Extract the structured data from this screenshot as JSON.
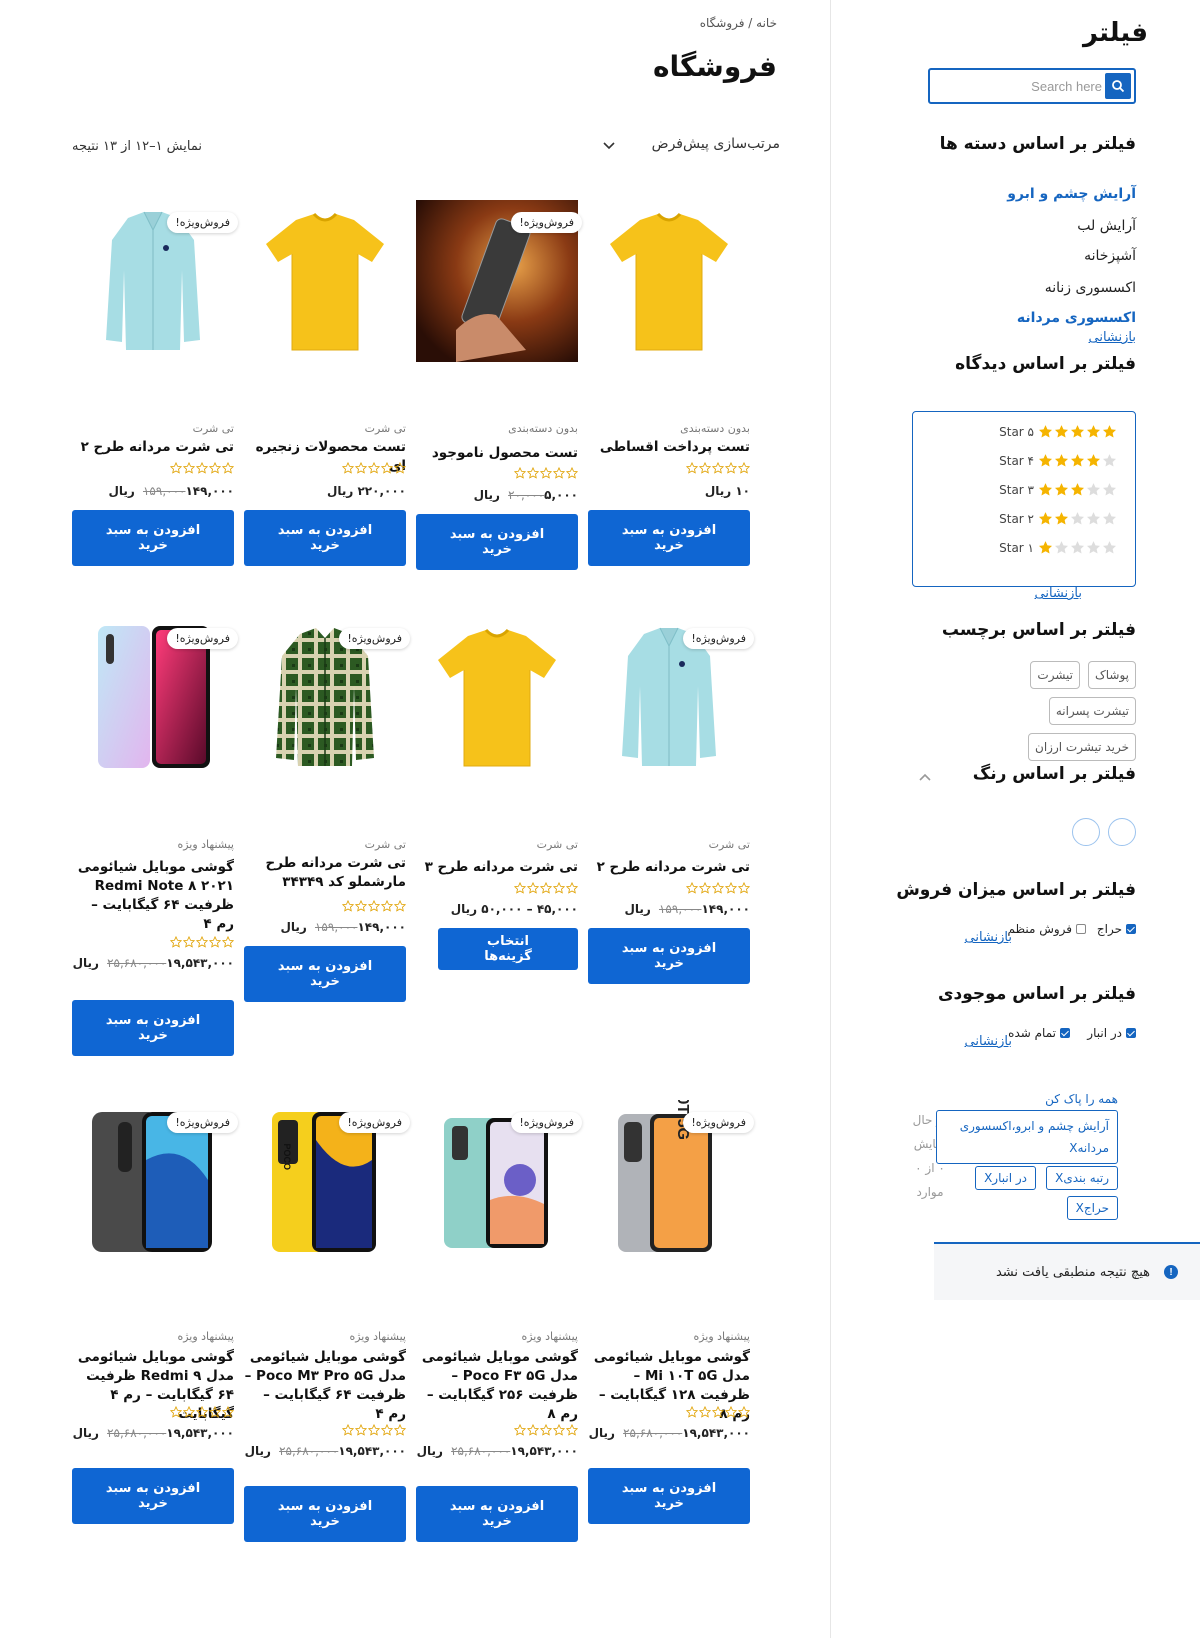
{
  "breadcrumb": "خانه / فروشگاه",
  "title": "فروشگاه",
  "sort_label": "مرتب‌سازی پیش‌فرض",
  "result_count": "نمایش ۱–۱۲ از ۱۳ نتیجه",
  "sidebar": {
    "title": "فیلتر",
    "search_placeholder": "Search here",
    "categories_title": "فیلتر بر اساس دسته ها",
    "categories": [
      {
        "label": "آرایش چشم و ابرو",
        "active": true
      },
      {
        "label": "آرایش لب",
        "active": false
      },
      {
        "label": "آشپزخانه",
        "active": false
      },
      {
        "label": "اکسسوری زنانه",
        "active": false
      },
      {
        "label": "اکسسوری مردانه",
        "active": true
      }
    ],
    "reset": "بازنشانی",
    "ratings_title": "فیلتر بر اساس دیدگاه",
    "ratings": [
      {
        "label": "Star ۵",
        "stars": 5
      },
      {
        "label": "Star ۴",
        "stars": 4
      },
      {
        "label": "Star ۳",
        "stars": 3
      },
      {
        "label": "Star ۲",
        "stars": 2
      },
      {
        "label": "Star ۱",
        "stars": 1
      }
    ],
    "tags_title": "فیلتر بر اساس برچسب",
    "tags": [
      "پوشاک",
      "تیشرت",
      "تیشرت پسرانه",
      "خرید تیشرت ارزان"
    ],
    "color_title": "فیلتر بر اساس رنگ",
    "sale_title": "فیلتر بر اساس میزان فروش",
    "sale_options": [
      {
        "label": "حراج",
        "checked": true
      },
      {
        "label": "فروش منظم",
        "checked": false
      }
    ],
    "stock_title": "فیلتر بر اساس موجودی",
    "stock_options": [
      {
        "label": "در انبار",
        "checked": true
      },
      {
        "label": "تمام شده",
        "checked": true
      }
    ],
    "clear_all": "همه را پاک کن",
    "showing_label": "در حال نمایش ۰ از ۰ موارد",
    "active_filters": [
      "آرایش چشم و ابرو،اکسسوری مردانهX",
      "رتبه بندیX",
      "در انبارX",
      "حراجX"
    ],
    "no_result": "هیچ نتیجه منطبقی یافت نشد",
    "accent": "#1565c0"
  },
  "products": [
    {
      "category": "بدون دسته‌بندی",
      "name": "تست پرداخت اقساطی",
      "price": "۱۰ ریال",
      "old_price": "",
      "button": "افزودن به سبد خرید",
      "sale": false,
      "image": "yellow-tshirt"
    },
    {
      "category": "بدون دسته‌بندی",
      "name": "تست محصول ناموجود",
      "price": "۵,۰۰۰ ریال",
      "old_price": "۲۰,۰۰۰",
      "button": "افزودن به سبد خرید",
      "sale": true,
      "image": "phone-hand"
    },
    {
      "category": "تی شرت",
      "name": "تست محصولات زنجیره ای",
      "price": "۲۲۰,۰۰۰ ریال",
      "old_price": "",
      "button": "افزودن به سبد خرید",
      "sale": false,
      "image": "yellow-tshirt"
    },
    {
      "category": "تی شرت",
      "name": "تی شرت مردانه طرح ۲",
      "price": "۱۴۹,۰۰۰ ریال",
      "old_price": "۱۵۹,۰۰۰",
      "button": "افزودن به سبد خرید",
      "sale": true,
      "image": "blue-shirt"
    },
    {
      "category": "تی شرت",
      "name": "تی شرت مردانه طرح ۲",
      "price": "۱۴۹,۰۰۰ ریال",
      "old_price": "۱۵۹,۰۰۰",
      "button": "افزودن به سبد خرید",
      "sale": true,
      "image": "blue-shirt"
    },
    {
      "category": "تی شرت",
      "name": "تی شرت مردانه طرح ۳",
      "price": "۴۵,۰۰۰ – ۵۰,۰۰۰ ریال",
      "old_price": "",
      "button": "انتخاب گزینه‌ها",
      "sale": false,
      "image": "yellow-tshirt"
    },
    {
      "category": "تی شرت",
      "name": "تی شرت مردانه طرح مارشملو کد ۳۴۳۴۹",
      "price": "۱۴۹,۰۰۰ ریال",
      "old_price": "۱۵۹,۰۰۰",
      "button": "افزودن به سبد خرید",
      "sale": true,
      "image": "plaid-shirt"
    },
    {
      "category": "پیشنهاد ویژه",
      "name": "گوشی موبایل شیائومی Redmi Note ۸ ۲۰۲۱ ظرفیت ۶۴ گیگابایت – رم ۴",
      "price": "۱۹,۵۴۳,۰۰۰ ریال",
      "old_price": "۲۵,۶۸۰,۰۰۰",
      "button": "افزودن به سبد خرید",
      "sale": true,
      "image": "redmi-note8"
    },
    {
      "category": "پیشنهاد ویژه",
      "name": "گوشی موبایل شیائومی مدل Mi ۱۰T ۵G – ظرفیت ۱۲۸ گیگابایت – رم ۸",
      "price": "۱۹,۵۴۳,۰۰۰ ریال",
      "old_price": "۲۵,۶۸۰,۰۰۰",
      "button": "افزودن به سبد خرید",
      "sale": true,
      "image": "mi10t"
    },
    {
      "category": "پیشنهاد ویژه",
      "name": "گوشی موبایل شیائومی مدل Poco F۳ ۵G – ظرفیت ۲۵۶ گیگابایت – رم ۸",
      "price": "۱۹,۵۴۳,۰۰۰ ریال",
      "old_price": "۲۵,۶۸۰,۰۰۰",
      "button": "افزودن به سبد خرید",
      "sale": true,
      "image": "poco-f3"
    },
    {
      "category": "پیشنهاد ویژه",
      "name": "گوشی موبایل شیائومی مدل Poco M۳ Pro ۵G – ظرفیت ۶۴ گیگابایت – رم ۴",
      "price": "۱۹,۵۴۳,۰۰۰ ریال",
      "old_price": "۲۵,۶۸۰,۰۰۰",
      "button": "افزودن به سبد خرید",
      "sale": true,
      "image": "poco-m3"
    },
    {
      "category": "پیشنهاد ویژه",
      "name": "گوشی موبایل شیائومی مدل Redmi ۹ ظرفیت ۶۴ گیگابایت – رم ۴ گیگابایت",
      "price": "۱۹,۵۴۳,۰۰۰ ریال",
      "old_price": "۲۵,۶۸۰,۰۰۰",
      "button": "افزودن به سبد خرید",
      "sale": true,
      "image": "redmi9"
    }
  ],
  "sale_badge": "فروش‌ویژه!"
}
